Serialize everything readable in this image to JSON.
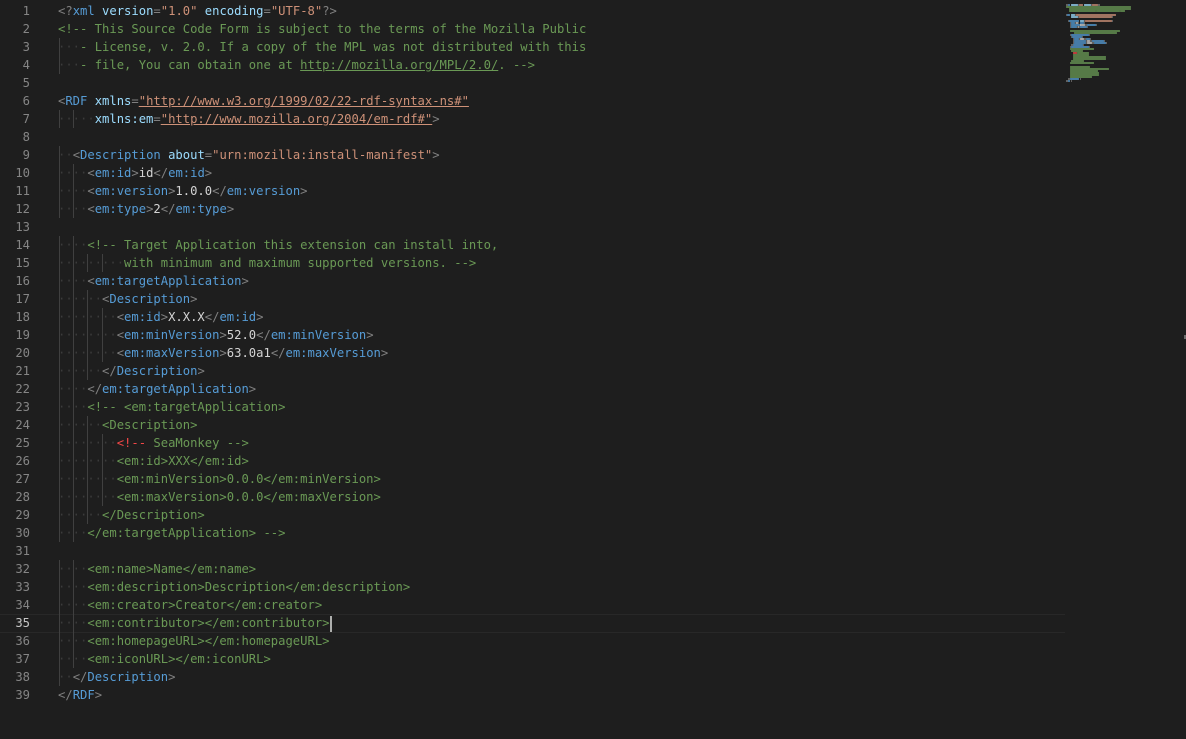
{
  "editor": {
    "current_line": 35,
    "lines": [
      [
        [
          "punc",
          "<?"
        ],
        [
          "tag",
          "xml"
        ],
        [
          "sp",
          " "
        ],
        [
          "attr",
          "version"
        ],
        [
          "punc",
          "="
        ],
        [
          "str",
          "\"1.0\""
        ],
        [
          "sp",
          " "
        ],
        [
          "attr",
          "encoding"
        ],
        [
          "punc",
          "="
        ],
        [
          "str",
          "\"UTF-8\""
        ],
        [
          "punc",
          "?>"
        ]
      ],
      [
        [
          "cmt",
          "<!-- This Source Code Form is subject to the terms of the Mozilla Public"
        ]
      ],
      [
        [
          "ws",
          "   "
        ],
        [
          "cmt",
          "- License, v. 2.0. If a copy of the MPL was not distributed with this"
        ]
      ],
      [
        [
          "ws",
          "   "
        ],
        [
          "cmt",
          "- file, You can obtain one at "
        ],
        [
          "linkc",
          "http://mozilla.org/MPL/2.0/"
        ],
        [
          "cmt",
          ". -->"
        ]
      ],
      [],
      [
        [
          "punc",
          "<"
        ],
        [
          "tag",
          "RDF"
        ],
        [
          "sp",
          " "
        ],
        [
          "attr",
          "xmlns"
        ],
        [
          "punc",
          "="
        ],
        [
          "link",
          "\"http://www.w3.org/1999/02/22-rdf-syntax-ns#\""
        ]
      ],
      [
        [
          "ws",
          "     "
        ],
        [
          "attr",
          "xmlns:em"
        ],
        [
          "punc",
          "="
        ],
        [
          "link",
          "\"http://www.mozilla.org/2004/em-rdf#\""
        ],
        [
          "punc",
          ">"
        ]
      ],
      [],
      [
        [
          "ws",
          "  "
        ],
        [
          "punc",
          "<"
        ],
        [
          "tag",
          "Description"
        ],
        [
          "sp",
          " "
        ],
        [
          "attr",
          "about"
        ],
        [
          "punc",
          "="
        ],
        [
          "str",
          "\"urn:mozilla:install-manifest\""
        ],
        [
          "punc",
          ">"
        ]
      ],
      [
        [
          "ws",
          "    "
        ],
        [
          "punc",
          "<"
        ],
        [
          "tag",
          "em:id"
        ],
        [
          "punc",
          ">"
        ],
        [
          "text",
          "id"
        ],
        [
          "punc",
          "</"
        ],
        [
          "tag",
          "em:id"
        ],
        [
          "punc",
          ">"
        ]
      ],
      [
        [
          "ws",
          "    "
        ],
        [
          "punc",
          "<"
        ],
        [
          "tag",
          "em:version"
        ],
        [
          "punc",
          ">"
        ],
        [
          "text",
          "1.0.0"
        ],
        [
          "punc",
          "</"
        ],
        [
          "tag",
          "em:version"
        ],
        [
          "punc",
          ">"
        ]
      ],
      [
        [
          "ws",
          "    "
        ],
        [
          "punc",
          "<"
        ],
        [
          "tag",
          "em:type"
        ],
        [
          "punc",
          ">"
        ],
        [
          "text",
          "2"
        ],
        [
          "punc",
          "</"
        ],
        [
          "tag",
          "em:type"
        ],
        [
          "punc",
          ">"
        ]
      ],
      [],
      [
        [
          "ws",
          "    "
        ],
        [
          "cmt",
          "<!-- Target Application this extension can install into,"
        ]
      ],
      [
        [
          "ws",
          "         "
        ],
        [
          "cmt",
          "with minimum and maximum supported versions. -->"
        ]
      ],
      [
        [
          "ws",
          "    "
        ],
        [
          "punc",
          "<"
        ],
        [
          "tag",
          "em:targetApplication"
        ],
        [
          "punc",
          ">"
        ]
      ],
      [
        [
          "ws",
          "      "
        ],
        [
          "punc",
          "<"
        ],
        [
          "tag",
          "Description"
        ],
        [
          "punc",
          ">"
        ]
      ],
      [
        [
          "ws",
          "        "
        ],
        [
          "punc",
          "<"
        ],
        [
          "tag",
          "em:id"
        ],
        [
          "punc",
          ">"
        ],
        [
          "text",
          "X.X.X"
        ],
        [
          "punc",
          "</"
        ],
        [
          "tag",
          "em:id"
        ],
        [
          "punc",
          ">"
        ]
      ],
      [
        [
          "ws",
          "        "
        ],
        [
          "punc",
          "<"
        ],
        [
          "tag",
          "em:minVersion"
        ],
        [
          "punc",
          ">"
        ],
        [
          "text",
          "52.0"
        ],
        [
          "punc",
          "</"
        ],
        [
          "tag",
          "em:minVersion"
        ],
        [
          "punc",
          ">"
        ]
      ],
      [
        [
          "ws",
          "        "
        ],
        [
          "punc",
          "<"
        ],
        [
          "tag",
          "em:maxVersion"
        ],
        [
          "punc",
          ">"
        ],
        [
          "text",
          "63.0a1"
        ],
        [
          "punc",
          "</"
        ],
        [
          "tag",
          "em:maxVersion"
        ],
        [
          "punc",
          ">"
        ]
      ],
      [
        [
          "ws",
          "      "
        ],
        [
          "punc",
          "</"
        ],
        [
          "tag",
          "Description"
        ],
        [
          "punc",
          ">"
        ]
      ],
      [
        [
          "ws",
          "    "
        ],
        [
          "punc",
          "</"
        ],
        [
          "tag",
          "em:targetApplication"
        ],
        [
          "punc",
          ">"
        ]
      ],
      [
        [
          "ws",
          "    "
        ],
        [
          "cmt",
          "<!-- <em:targetApplication>"
        ]
      ],
      [
        [
          "ws",
          "      "
        ],
        [
          "cmt",
          "<Description>"
        ]
      ],
      [
        [
          "ws",
          "        "
        ],
        [
          "red",
          "<!--"
        ],
        [
          "cmt",
          " SeaMonkey -->"
        ]
      ],
      [
        [
          "ws",
          "        "
        ],
        [
          "cmt",
          "<em:id>XXX</em:id>"
        ]
      ],
      [
        [
          "ws",
          "        "
        ],
        [
          "cmt",
          "<em:minVersion>0.0.0</em:minVersion>"
        ]
      ],
      [
        [
          "ws",
          "        "
        ],
        [
          "cmt",
          "<em:maxVersion>0.0.0</em:maxVersion>"
        ]
      ],
      [
        [
          "ws",
          "      "
        ],
        [
          "cmt",
          "</Description>"
        ]
      ],
      [
        [
          "ws",
          "    "
        ],
        [
          "cmt",
          "</em:targetApplication> -->"
        ]
      ],
      [],
      [
        [
          "ws",
          "    "
        ],
        [
          "cmt",
          "<em:name>Name</em:name>"
        ]
      ],
      [
        [
          "ws",
          "    "
        ],
        [
          "cmt",
          "<em:description>Description</em:description>"
        ]
      ],
      [
        [
          "ws",
          "    "
        ],
        [
          "cmt",
          "<em:creator>Creator</em:creator>"
        ]
      ],
      [
        [
          "ws",
          "    "
        ],
        [
          "cmt",
          "<em:contributor></em:contributor>"
        ]
      ],
      [
        [
          "ws",
          "    "
        ],
        [
          "cmt",
          "<em:homepageURL></em:homepageURL>"
        ]
      ],
      [
        [
          "ws",
          "    "
        ],
        [
          "cmt",
          "<em:iconURL></em:iconURL>"
        ]
      ],
      [
        [
          "ws",
          "  "
        ],
        [
          "punc",
          "</"
        ],
        [
          "tag",
          "Description"
        ],
        [
          "punc",
          ">"
        ]
      ],
      [
        [
          "punc",
          "</"
        ],
        [
          "tag",
          "RDF"
        ],
        [
          "punc",
          ">"
        ]
      ]
    ]
  }
}
